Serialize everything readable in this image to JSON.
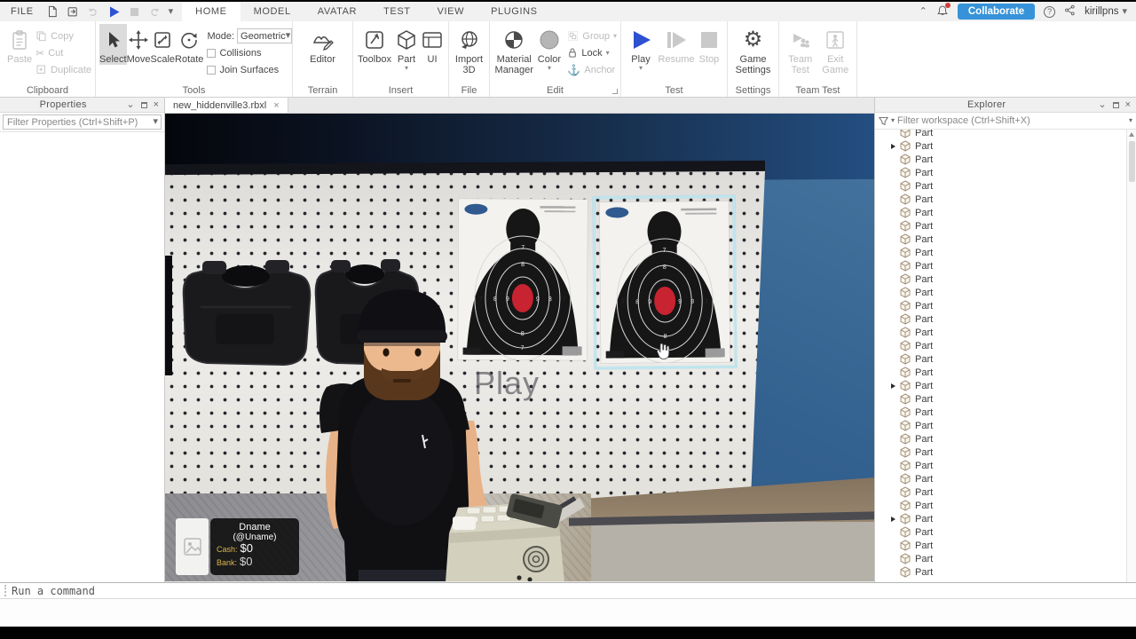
{
  "titlebar": {
    "file_menu": "FILE",
    "tabs": [
      "HOME",
      "MODEL",
      "AVATAR",
      "TEST",
      "VIEW",
      "PLUGINS"
    ],
    "active_tab": "HOME",
    "collaborate_label": "Collaborate",
    "username": "kirillpns"
  },
  "ribbon": {
    "clipboard": {
      "label": "Clipboard",
      "paste": "Paste",
      "copy": "Copy",
      "cut": "Cut",
      "duplicate": "Duplicate"
    },
    "tools": {
      "label": "Tools",
      "select": "Select",
      "move": "Move",
      "scale": "Scale",
      "rotate": "Rotate",
      "mode_label": "Mode:",
      "mode_value": "Geometric",
      "collisions": "Collisions",
      "join_surfaces": "Join Surfaces"
    },
    "terrain": {
      "label": "Terrain",
      "editor": "Editor"
    },
    "insert": {
      "label": "Insert",
      "toolbox": "Toolbox",
      "part": "Part",
      "ui": "UI"
    },
    "file": {
      "label": "File",
      "import_line1": "Import",
      "import_line2": "3D"
    },
    "edit": {
      "label": "Edit",
      "material_line1": "Material",
      "material_line2": "Manager",
      "color": "Color",
      "group": "Group",
      "lock": "Lock",
      "anchor": "Anchor"
    },
    "test": {
      "label": "Test",
      "play": "Play",
      "resume": "Resume",
      "stop": "Stop"
    },
    "settings": {
      "label": "Settings",
      "game_line1": "Game",
      "game_line2": "Settings"
    },
    "team_test": {
      "label": "Team Test",
      "team_line1": "Team",
      "team_line2": "Test",
      "exit_line1": "Exit",
      "exit_line2": "Game"
    }
  },
  "properties_panel": {
    "title": "Properties",
    "filter_placeholder": "Filter Properties (Ctrl+Shift+P)"
  },
  "explorer_panel": {
    "title": "Explorer",
    "filter_placeholder": "Filter workspace (Ctrl+Shift+X)",
    "items": [
      "Part",
      "Part",
      "Part",
      "Part",
      "Part",
      "Part",
      "Part",
      "Part",
      "Part",
      "Part",
      "Part",
      "Part",
      "Part",
      "Part",
      "Part",
      "Part",
      "Part",
      "Part",
      "Part",
      "Part",
      "Part",
      "Part",
      "Part",
      "Part",
      "Part",
      "Part",
      "Part",
      "Part",
      "Part",
      "Part",
      "Part",
      "Part",
      "Part",
      "Part"
    ],
    "expandable_rows": [
      1,
      19,
      29
    ]
  },
  "document_tab": {
    "title": "new_hiddenville3.rbxl",
    "close": "×"
  },
  "viewport_overlay": {
    "play_text": "Play",
    "nametag": {
      "display_name": "Dname",
      "username": "(@Uname)",
      "cash_label": "Cash:",
      "cash_value": "$0",
      "bank_label": "Bank:",
      "bank_value": "$0"
    },
    "target_ring_numbers": [
      "7",
      "8",
      "9"
    ]
  },
  "command_bar": {
    "placeholder": "Run a command"
  },
  "icons": {
    "caret_down_glyph": "▾",
    "chevron_down_glyph": "⌄",
    "chevron_up_glyph": "⌃",
    "close_glyph": "×",
    "help_glyph": "?",
    "gear_glyph": "⚙",
    "anchor_glyph": "⚓",
    "scissors_glyph": "✂"
  },
  "colors": {
    "collaborate_blue": "#3693d9",
    "play_blue": "#2e51d0",
    "selection_outline": "#b9e6f0",
    "bullseye_red": "#c82330",
    "wall_blue": "#33618f",
    "cash_gold": "#d9b64a"
  }
}
